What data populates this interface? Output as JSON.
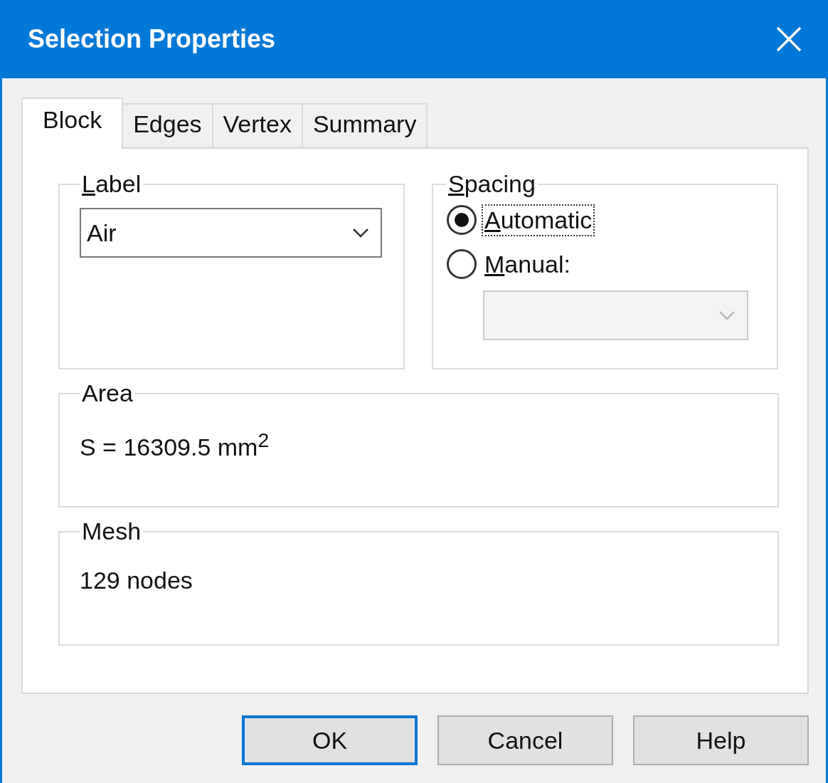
{
  "window": {
    "title": "Selection Properties"
  },
  "tabs": [
    {
      "label": "Block",
      "selected": true
    },
    {
      "label": "Edges",
      "selected": false
    },
    {
      "label": "Vertex",
      "selected": false
    },
    {
      "label": "Summary",
      "selected": false
    }
  ],
  "label_group": {
    "title": "Label",
    "underline_first": true,
    "dropdown": {
      "value": "Air"
    }
  },
  "spacing_group": {
    "title": "Spacing",
    "underline_first": true,
    "options": [
      {
        "label": "Automatic",
        "underline_first": true,
        "selected": true,
        "focused": true
      },
      {
        "label": "Manual:",
        "underline_first": true,
        "selected": false,
        "focused": false
      }
    ],
    "manual_dropdown": {
      "disabled": true
    }
  },
  "area_group": {
    "title": "Area",
    "text": "S = 16309.5 mm$^{2}$"
  },
  "mesh_group": {
    "title": "Mesh",
    "text": "129 nodes"
  },
  "buttons": [
    {
      "label": "OK",
      "default": true
    },
    {
      "label": "Cancel",
      "default": false
    },
    {
      "label": "Help",
      "default": false
    }
  ]
}
